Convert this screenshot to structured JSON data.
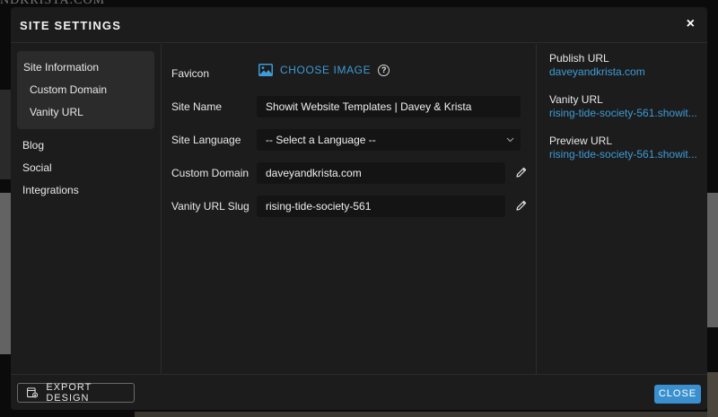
{
  "background": {
    "top_text": "NDKRISTA.COM"
  },
  "modal": {
    "title": "SITE SETTINGS",
    "close_glyph": "×"
  },
  "sidebar": {
    "group": [
      {
        "label": "Site Information"
      },
      {
        "label": "Custom Domain"
      },
      {
        "label": "Vanity URL"
      }
    ],
    "items": [
      {
        "label": "Blog"
      },
      {
        "label": "Social"
      },
      {
        "label": "Integrations"
      }
    ]
  },
  "form": {
    "favicon_label": "Favicon",
    "choose_image_label": "CHOOSE IMAGE",
    "help_glyph": "?",
    "site_name_label": "Site Name",
    "site_name_value": "Showit Website Templates | Davey & Krista",
    "site_language_label": "Site Language",
    "site_language_value": "-- Select a Language --",
    "custom_domain_label": "Custom Domain",
    "custom_domain_value": "daveyandkrista.com",
    "vanity_slug_label": "Vanity URL Slug",
    "vanity_slug_value": "rising-tide-society-561"
  },
  "urls": {
    "publish_label": "Publish URL",
    "publish_value": "daveyandkrista.com",
    "vanity_label": "Vanity URL",
    "vanity_value": "rising-tide-society-561.showit...",
    "preview_label": "Preview URL",
    "preview_value": "rising-tide-society-561.showit..."
  },
  "footer": {
    "export_label": "EXPORT DESIGN",
    "close_label": "CLOSE"
  },
  "colors": {
    "accent": "#3a90cf",
    "link": "#3d9bd6",
    "modal_bg": "#1c1c1c",
    "field_bg": "#141414"
  },
  "icons": [
    "close-icon",
    "image-icon",
    "help-icon",
    "chevron-down-icon",
    "pencil-icon",
    "export-icon"
  ]
}
